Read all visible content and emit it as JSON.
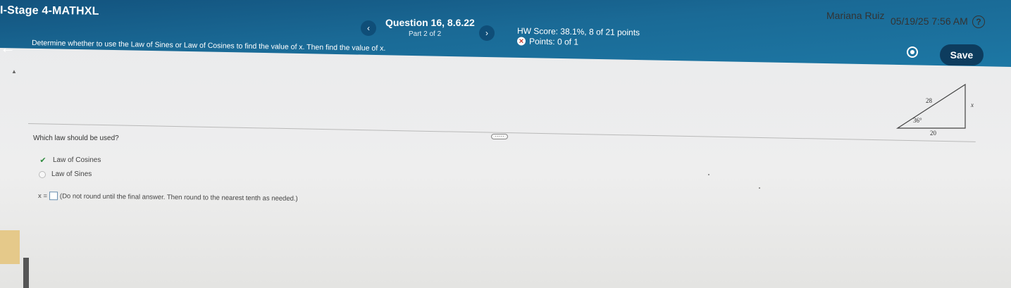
{
  "header": {
    "app_title": "I-Stage 4-MATHXL",
    "user_name": "Mariana Ruiz",
    "datetime": "05/19/25 7:56 AM",
    "help_glyph": "?",
    "question_title": "Question 16, 8.6.22",
    "question_part": "Part 2 of 2",
    "hw_score": "HW Score: 38.1%, 8 of 21 points",
    "points": "Points: 0 of 1",
    "save_label": "Save",
    "prev_glyph": "‹",
    "next_glyph": "›",
    "back_glyph": "←"
  },
  "question": {
    "instructions": "Determine whether to use the Law of Sines or Law of Cosines to find the value of x. Then find the value of x.",
    "figure": {
      "side_top": "28",
      "side_right": "x",
      "side_bottom": "20",
      "angle": "36°"
    },
    "more_glyph": "·····",
    "prompt": "Which law should be used?",
    "options": [
      {
        "label": "Law of Cosines",
        "selected": true
      },
      {
        "label": "Law of Sines",
        "selected": false
      }
    ],
    "answer_prefix": "x =",
    "answer_value": "",
    "answer_note": "(Do not round until the final answer. Then round to the nearest tenth as needed.)"
  },
  "icons": {
    "help": "help-circle-icon",
    "gear": "gear-icon",
    "incorrect": "x-circle-icon",
    "check": "checkmark-icon",
    "back": "back-arrow-icon"
  },
  "colors": {
    "header_blue": "#1a6a96",
    "save_button": "#0d3c5e",
    "correct_green": "#2e8b3d"
  }
}
